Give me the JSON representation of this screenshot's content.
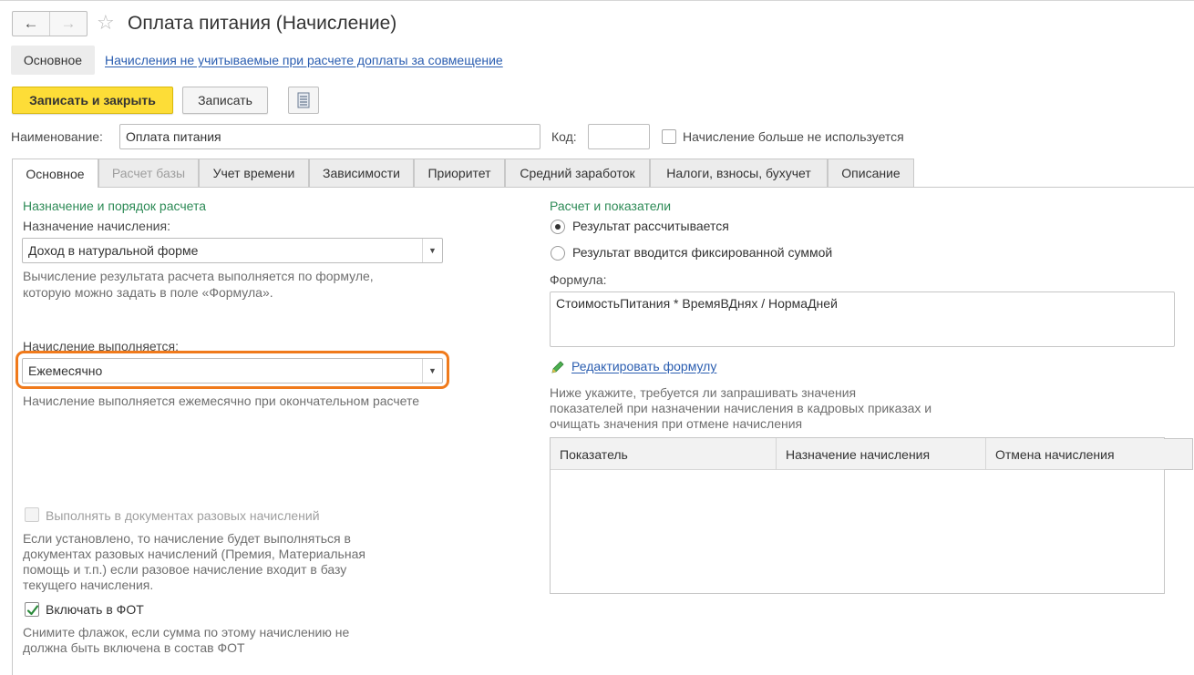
{
  "window": {
    "title": "Оплата питания (Начисление)"
  },
  "sections": {
    "main": "Основное",
    "link": "Начисления не учитываемые при расчете доплаты за совмещение"
  },
  "toolbar": {
    "save_close": "Записать и закрыть",
    "save": "Записать"
  },
  "header": {
    "name_label": "Наименование:",
    "name_value": "Оплата питания",
    "code_label": "Код:",
    "code_value": "",
    "unused_label": "Начисление больше не используется"
  },
  "tabs": [
    {
      "label": "Основное"
    },
    {
      "label": "Расчет базы"
    },
    {
      "label": "Учет времени"
    },
    {
      "label": "Зависимости"
    },
    {
      "label": "Приоритет"
    },
    {
      "label": "Средний заработок"
    },
    {
      "label": "Налоги, взносы, бухучет"
    },
    {
      "label": "Описание"
    }
  ],
  "left": {
    "group_title": "Назначение и порядок расчета",
    "purpose_label": "Назначение начисления:",
    "purpose_value": "Доход в натуральной форме",
    "purpose_hint_1": "Вычисление результата расчета выполняется по формуле,",
    "purpose_hint_2": "которую можно задать в поле «Формула».",
    "period_label": "Начисление выполняется:",
    "period_value": "Ежемесячно",
    "period_hint": "Начисление выполняется ежемесячно при окончательном расчете",
    "onetime_label": "Выполнять в документах разовых начислений",
    "onetime_hint_1": "Если установлено, то начисление будет выполняться в",
    "onetime_hint_2": "документах разовых начислений (Премия, Материальная",
    "onetime_hint_3": "помощь и т.п.) если разовое начисление входит в базу",
    "onetime_hint_4": "текущего начисления.",
    "fot_label": "Включать в ФОТ",
    "fot_hint_1": "Снимите флажок, если сумма по этому начислению не",
    "fot_hint_2": "должна быть включена в состав ФОТ"
  },
  "right": {
    "group_title": "Расчет и показатели",
    "radio_calc": "Результат рассчитывается",
    "radio_fixed": "Результат вводится фиксированной суммой",
    "formula_label": "Формула:",
    "formula_value": "СтоимостьПитания * ВремяВДнях / НормаДней",
    "edit_formula": "Редактировать формулу",
    "hint_1": "Ниже укажите, требуется ли запрашивать значения",
    "hint_2": "показателей при назначении начисления в кадровых приказах и",
    "hint_3": "очищать значения при отмене начисления",
    "table_headers": [
      "Показатель",
      "Назначение начисления",
      "Отмена начисления"
    ]
  },
  "icons": {
    "back": "arrow-left-icon",
    "forward": "arrow-right-icon",
    "favorite": "star-icon",
    "report": "document-icon",
    "edit": "pencil-icon",
    "dropdown": "chevron-down-icon"
  },
  "colors": {
    "accent_yellow": "#fddd37",
    "group_green": "#2e8b57",
    "link_blue": "#2a5db0",
    "highlight_orange": "#f07a1b"
  }
}
